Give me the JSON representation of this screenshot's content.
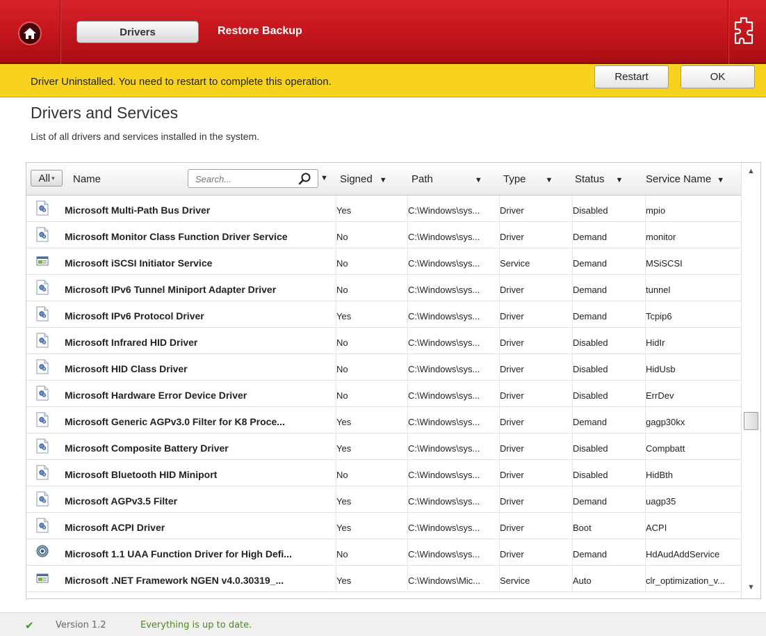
{
  "header": {
    "tabs": [
      {
        "label": "Drivers",
        "active": true
      },
      {
        "label": "Restore Backup",
        "active": false
      }
    ],
    "home_icon": "home-icon",
    "plugin_icon": "plugin-icon"
  },
  "notification": {
    "message": "Driver Uninstalled. You need to restart to complete this operation.",
    "restart_label": "Restart",
    "ok_label": "OK"
  },
  "page": {
    "title": "Drivers and Services",
    "subtitle": "List of all drivers and services installed in the system."
  },
  "table": {
    "filter_label": "All",
    "search_placeholder": "Search...",
    "columns": [
      "Name",
      "Signed",
      "Path",
      "Type",
      "Status",
      "Service Name"
    ],
    "rows": [
      {
        "icon": "driver-icon",
        "name": "Microsoft Multi-Path Bus Driver",
        "signed": "Yes",
        "path": "C:\\Windows\\sys...",
        "type": "Driver",
        "status": "Disabled",
        "service": "mpio"
      },
      {
        "icon": "driver-icon",
        "name": "Microsoft Monitor Class Function Driver Service",
        "signed": "No",
        "path": "C:\\Windows\\sys...",
        "type": "Driver",
        "status": "Demand",
        "service": "monitor"
      },
      {
        "icon": "service-icon",
        "name": "Microsoft iSCSI Initiator Service",
        "signed": "No",
        "path": "C:\\Windows\\sys...",
        "type": "Service",
        "status": "Demand",
        "service": "MSiSCSI"
      },
      {
        "icon": "driver-icon",
        "name": "Microsoft IPv6 Tunnel Miniport Adapter Driver",
        "signed": "No",
        "path": "C:\\Windows\\sys...",
        "type": "Driver",
        "status": "Demand",
        "service": "tunnel"
      },
      {
        "icon": "driver-icon",
        "name": "Microsoft IPv6 Protocol Driver",
        "signed": "Yes",
        "path": "C:\\Windows\\sys...",
        "type": "Driver",
        "status": "Demand",
        "service": "Tcpip6"
      },
      {
        "icon": "driver-icon",
        "name": "Microsoft Infrared HID Driver",
        "signed": "No",
        "path": "C:\\Windows\\sys...",
        "type": "Driver",
        "status": "Disabled",
        "service": "HidIr"
      },
      {
        "icon": "driver-icon",
        "name": "Microsoft HID Class Driver",
        "signed": "No",
        "path": "C:\\Windows\\sys...",
        "type": "Driver",
        "status": "Disabled",
        "service": "HidUsb"
      },
      {
        "icon": "driver-icon",
        "name": "Microsoft Hardware Error Device Driver",
        "signed": "No",
        "path": "C:\\Windows\\sys...",
        "type": "Driver",
        "status": "Disabled",
        "service": "ErrDev"
      },
      {
        "icon": "driver-icon",
        "name": "Microsoft Generic AGPv3.0 Filter for K8 Proce...",
        "signed": "Yes",
        "path": "C:\\Windows\\sys...",
        "type": "Driver",
        "status": "Demand",
        "service": "gagp30kx"
      },
      {
        "icon": "driver-icon",
        "name": "Microsoft Composite Battery Driver",
        "signed": "Yes",
        "path": "C:\\Windows\\sys...",
        "type": "Driver",
        "status": "Disabled",
        "service": "Compbatt"
      },
      {
        "icon": "driver-icon",
        "name": "Microsoft Bluetooth HID Miniport",
        "signed": "No",
        "path": "C:\\Windows\\sys...",
        "type": "Driver",
        "status": "Disabled",
        "service": "HidBth"
      },
      {
        "icon": "driver-icon",
        "name": "Microsoft AGPv3.5 Filter",
        "signed": "Yes",
        "path": "C:\\Windows\\sys...",
        "type": "Driver",
        "status": "Demand",
        "service": "uagp35"
      },
      {
        "icon": "driver-icon",
        "name": "Microsoft ACPI Driver",
        "signed": "Yes",
        "path": "C:\\Windows\\sys...",
        "type": "Driver",
        "status": "Boot",
        "service": "ACPI"
      },
      {
        "icon": "audio-driver-icon",
        "name": "Microsoft 1.1 UAA Function Driver for High Defi...",
        "signed": "No",
        "path": "C:\\Windows\\sys...",
        "type": "Driver",
        "status": "Demand",
        "service": "HdAudAddService"
      },
      {
        "icon": "service-icon",
        "name": "Microsoft .NET Framework NGEN v4.0.30319_...",
        "signed": "Yes",
        "path": "C:\\Windows\\Mic...",
        "type": "Service",
        "status": "Auto",
        "service": "clr_optimization_v..."
      }
    ]
  },
  "footer": {
    "version": "Version 1.2",
    "status": "Everything is up to date."
  },
  "colors": {
    "header_red": "#c2151c",
    "notify_yellow": "#f7d31f",
    "ok_green": "#3a9a1a"
  }
}
